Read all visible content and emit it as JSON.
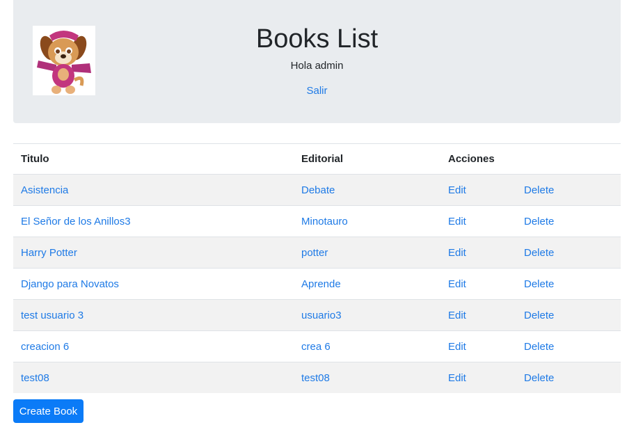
{
  "header": {
    "title": "Books List",
    "greeting": "Hola admin",
    "logout_label": "Salir"
  },
  "table": {
    "columns": [
      "Titulo",
      "Editorial",
      "Acciones"
    ],
    "edit_label": "Edit",
    "delete_label": "Delete",
    "rows": [
      {
        "titulo": "Asistencia",
        "editorial": "Debate"
      },
      {
        "titulo": "El Señor de los Anillos3",
        "editorial": "Minotauro"
      },
      {
        "titulo": "Harry Potter",
        "editorial": "potter"
      },
      {
        "titulo": "Django para Novatos",
        "editorial": "Aprende"
      },
      {
        "titulo": "test usuario 3",
        "editorial": "usuario3"
      },
      {
        "titulo": "creacion 6",
        "editorial": "crea 6"
      },
      {
        "titulo": "test08",
        "editorial": "test08"
      }
    ]
  },
  "actions": {
    "create_label": "Create Book"
  },
  "colors": {
    "link": "#1e7ae6",
    "primary_button": "#0b7bf7",
    "header_bg": "#e9ecef",
    "stripe": "#f2f2f2"
  }
}
